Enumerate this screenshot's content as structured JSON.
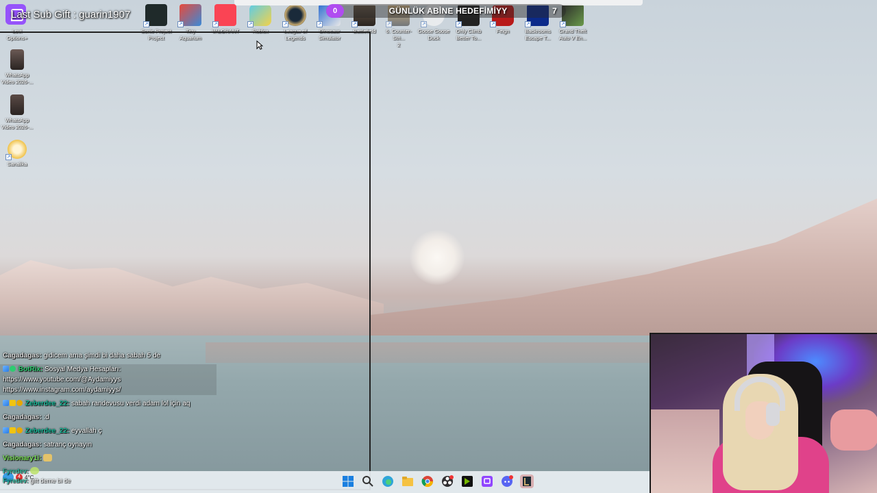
{
  "overlay": {
    "last_sub_gift": "Last Sub Gift : guarin1907",
    "goal_count": "0",
    "goal_title": "GÜNLÜK ABİNE HEDEFİMİYY",
    "goal_target": "7"
  },
  "desktop_left": [
    {
      "label": "Lovi\nOptions+"
    },
    {
      "label": "WhatsApp\nVideo 2026-..."
    },
    {
      "label": "WhatsApp\nVideo 2026-..."
    },
    {
      "label": "Sanalika"
    }
  ],
  "desktop_top": [
    {
      "label": "Sonic Project\nProject"
    },
    {
      "label": "Tiny\nAquarium"
    },
    {
      "label": "VALORANT"
    },
    {
      "label": "Roblox"
    },
    {
      "label": "League of\nLegends"
    },
    {
      "label": "Dinosaur\nSimulator"
    },
    {
      "label": "Battlefield"
    },
    {
      "label": "6. Counter-Stri...\n2"
    },
    {
      "label": "Goose Goose\nDuck"
    },
    {
      "label": "Only Climb\nBetter To..."
    },
    {
      "label": "Feign"
    },
    {
      "label": "Backrooms\nEscape T..."
    },
    {
      "label": "Grand Theft\nAuto V En..."
    }
  ],
  "chat": {
    "m1_user": "Cagadagas:",
    "m1_text": "gidicem ama şimdi bi daha sabah 5 de",
    "m2_user": "BotRix:",
    "m2_text": "Sosyal Medya Hesapları:",
    "m2_link1": "https://www.youtube.com/@Aydamiyys",
    "m2_link2": "https://www.instagram.com/aydamiyys/",
    "m3_user": "Zeberdee_22:",
    "m3_text": "sabah randevusu verdi adam lol için aq",
    "m4_user": "Cagadagas:",
    "m4_text": ":d",
    "m5_user": "Zeberdee_22:",
    "m5_text": "eyvallah ç",
    "m6_user": "Cagadagas:",
    "m6_text": "satranç oynayın",
    "m7_user": "Visionary1i:",
    "m8_user": "Fyredev:",
    "m9_user": "Fyredev:",
    "m9_text": "gift deme bi de"
  },
  "taskbar": {
    "weather_temp": "4°C",
    "weather_badge": "4"
  },
  "colors": {
    "accent": "#9146ff",
    "goal_pill": "#b04cf0",
    "chat_green": "#2ecc71",
    "chat_teal": "#1abc9c"
  }
}
